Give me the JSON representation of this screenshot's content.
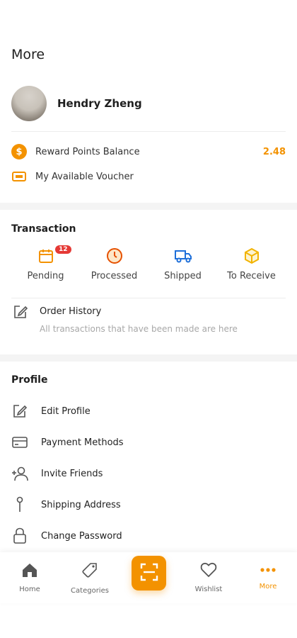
{
  "header": {
    "title": "More"
  },
  "user": {
    "name": "Hendry Zheng",
    "reward_label": "Reward Points Balance",
    "reward_value": "2.48",
    "voucher_label": "My Available Voucher"
  },
  "transaction": {
    "title": "Transaction",
    "items": [
      {
        "label": "Pending",
        "icon": "calendar-icon",
        "badge": "12"
      },
      {
        "label": "Processed",
        "icon": "clock-icon"
      },
      {
        "label": "Shipped",
        "icon": "truck-icon"
      },
      {
        "label": "To Receive",
        "icon": "box-icon"
      }
    ],
    "history_title": "Order History",
    "history_sub": "All transactions that have been made are here"
  },
  "profile": {
    "title": "Profile",
    "items": [
      {
        "label": "Edit Profile",
        "icon": "edit-icon"
      },
      {
        "label": "Payment Methods",
        "icon": "card-icon"
      },
      {
        "label": "Invite Friends",
        "icon": "add-user-icon"
      },
      {
        "label": "Shipping Address",
        "icon": "pin-icon"
      },
      {
        "label": "Change Password",
        "icon": "lock-icon"
      }
    ]
  },
  "nav": {
    "items": [
      {
        "label": "Home",
        "icon": "home-icon"
      },
      {
        "label": "Categories",
        "icon": "tag-icon"
      },
      {
        "label": "",
        "icon": "scan-icon"
      },
      {
        "label": "Wishlist",
        "icon": "heart-icon"
      },
      {
        "label": "More",
        "icon": "more-icon",
        "active": true
      }
    ]
  },
  "colors": {
    "accent": "#f39200",
    "badge": "#e53935"
  }
}
